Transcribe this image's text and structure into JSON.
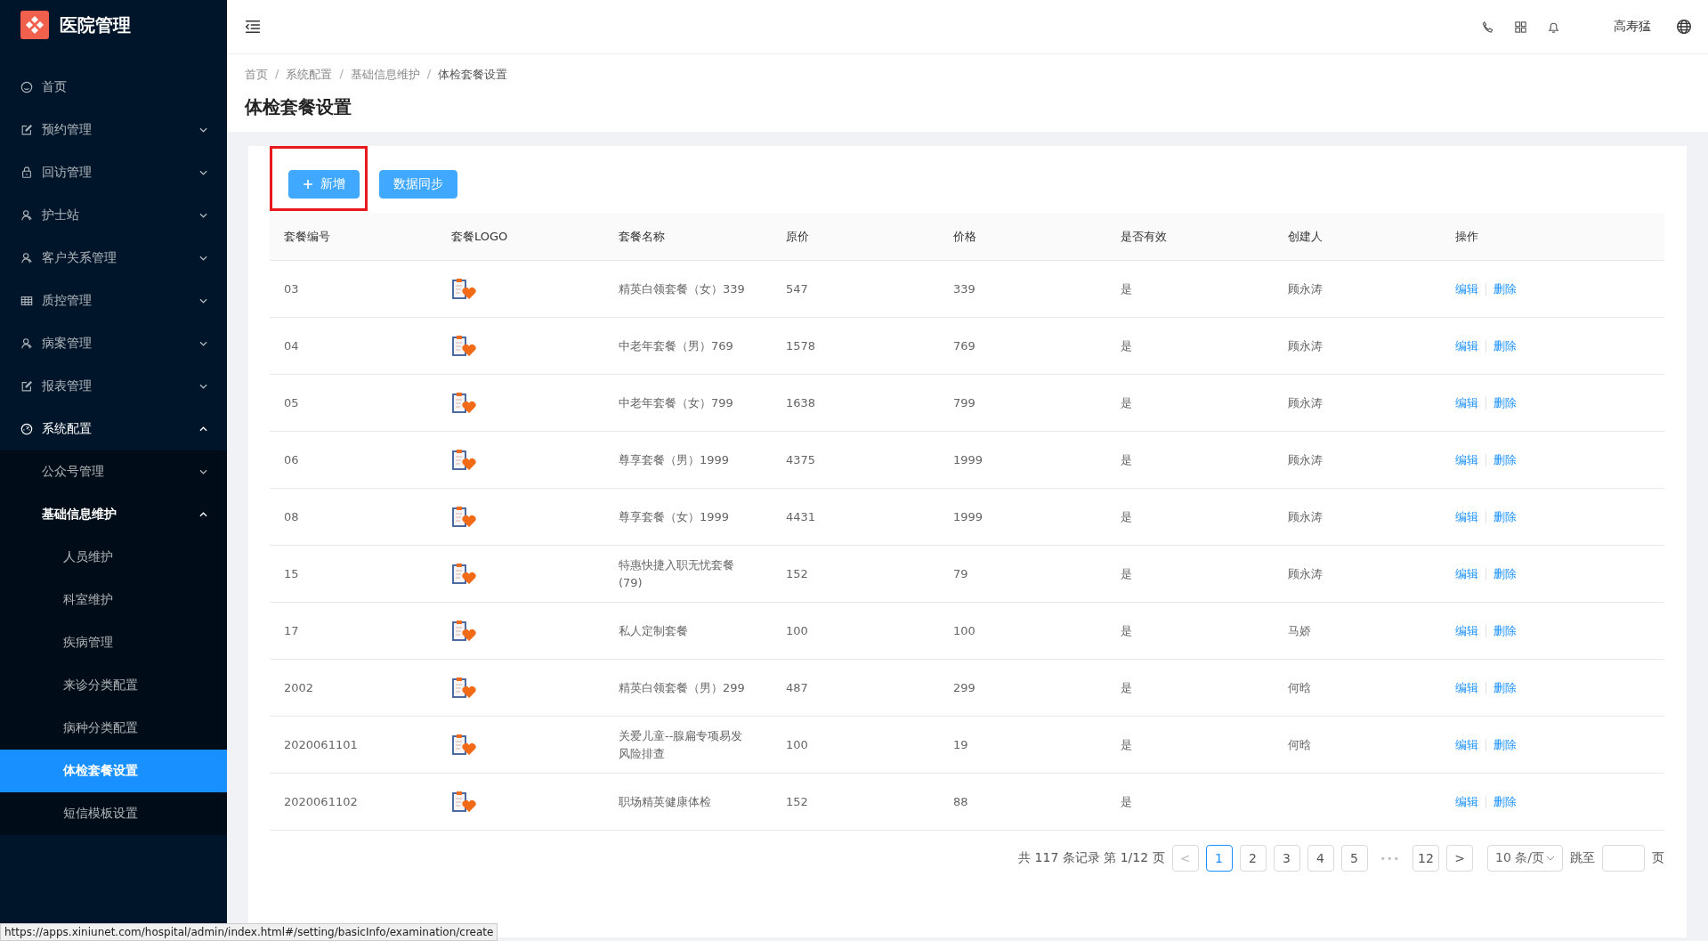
{
  "app": {
    "title": "医院管理"
  },
  "sidebar": {
    "items": [
      {
        "label": "首页",
        "kind": "link",
        "selected": false
      },
      {
        "label": "预约管理",
        "kind": "group",
        "expanded": false,
        "selected": false
      },
      {
        "label": "回访管理",
        "kind": "group",
        "expanded": false,
        "selected": false
      },
      {
        "label": "护士站",
        "kind": "group",
        "expanded": false,
        "selected": false
      },
      {
        "label": "客户关系管理",
        "kind": "group",
        "expanded": false,
        "selected": false
      },
      {
        "label": "质控管理",
        "kind": "group",
        "expanded": false,
        "selected": false
      },
      {
        "label": "病案管理",
        "kind": "group",
        "expanded": false,
        "selected": false
      },
      {
        "label": "报表管理",
        "kind": "group",
        "expanded": false,
        "selected": false
      },
      {
        "label": "系统配置",
        "kind": "group",
        "expanded": true,
        "selected": false,
        "children": [
          {
            "label": "公众号管理",
            "kind": "group",
            "expanded": false,
            "selected": false
          },
          {
            "label": "基础信息维护",
            "kind": "group",
            "expanded": true,
            "selected": false,
            "children": [
              {
                "label": "人员维护",
                "selected": false
              },
              {
                "label": "科室维护",
                "selected": false
              },
              {
                "label": "疾病管理",
                "selected": false
              },
              {
                "label": "来诊分类配置",
                "selected": false
              },
              {
                "label": "病种分类配置",
                "selected": false
              },
              {
                "label": "体检套餐设置",
                "selected": true
              },
              {
                "label": "短信模板设置",
                "selected": false
              }
            ]
          }
        ]
      }
    ]
  },
  "header": {
    "user": "高寿猛"
  },
  "breadcrumb": {
    "separator": "/",
    "items": [
      "首页",
      "系统配置",
      "基础信息维护",
      "体检套餐设置"
    ]
  },
  "page_title": "体检套餐设置",
  "toolbar": [
    {
      "label": "新增",
      "kind": "add",
      "highlighted": true
    },
    {
      "label": "数据同步",
      "kind": "plain",
      "highlighted": false
    }
  ],
  "table": {
    "columns": [
      "套餐编号",
      "套餐LOGO",
      "套餐名称",
      "原价",
      "价格",
      "是否有效",
      "创建人",
      "操作"
    ],
    "rows": [
      {
        "code": "03",
        "name": "精英白领套餐（女）339",
        "original_price": "547",
        "price": "339",
        "valid": "是",
        "creator": "顾永涛",
        "actions": [
          "编辑",
          "删除"
        ]
      },
      {
        "code": "04",
        "name": "中老年套餐（男）769",
        "original_price": "1578",
        "price": "769",
        "valid": "是",
        "creator": "顾永涛",
        "actions": [
          "编辑",
          "删除"
        ]
      },
      {
        "code": "05",
        "name": "中老年套餐（女）799",
        "original_price": "1638",
        "price": "799",
        "valid": "是",
        "creator": "顾永涛",
        "actions": [
          "编辑",
          "删除"
        ]
      },
      {
        "code": "06",
        "name": "尊享套餐（男）1999",
        "original_price": "4375",
        "price": "1999",
        "valid": "是",
        "creator": "顾永涛",
        "actions": [
          "编辑",
          "删除"
        ]
      },
      {
        "code": "08",
        "name": "尊享套餐（女）1999",
        "original_price": "4431",
        "price": "1999",
        "valid": "是",
        "creator": "顾永涛",
        "actions": [
          "编辑",
          "删除"
        ]
      },
      {
        "code": "15",
        "name": "特惠快捷入职无忧套餐(79)",
        "original_price": "152",
        "price": "79",
        "valid": "是",
        "creator": "顾永涛",
        "actions": [
          "编辑",
          "删除"
        ]
      },
      {
        "code": "17",
        "name": "私人定制套餐",
        "original_price": "100",
        "price": "100",
        "valid": "是",
        "creator": "马娇",
        "actions": [
          "编辑",
          "删除"
        ]
      },
      {
        "code": "2002",
        "name": "精英白领套餐（男）299",
        "original_price": "487",
        "price": "299",
        "valid": "是",
        "creator": "何晗",
        "actions": [
          "编辑",
          "删除"
        ]
      },
      {
        "code": "2020061101",
        "name": "关爱儿童--腺扁专项易发风险排查",
        "original_price": "100",
        "price": "19",
        "valid": "是",
        "creator": "何晗",
        "actions": [
          "编辑",
          "删除"
        ]
      },
      {
        "code": "2020061102",
        "name": "职场精英健康体检",
        "original_price": "152",
        "price": "88",
        "valid": "是",
        "actions": [
          "编辑",
          "删除"
        ]
      }
    ]
  },
  "pagination": {
    "summary": "共 117 条记录 第 1/12 页",
    "prev": "<",
    "pages": [
      {
        "label": "1",
        "selected": true
      },
      {
        "label": "2",
        "selected": false
      },
      {
        "label": "3",
        "selected": false
      },
      {
        "label": "4",
        "selected": false
      },
      {
        "label": "5",
        "selected": false
      }
    ],
    "ellipsis": "•••",
    "last": {
      "label": "12",
      "selected": false
    },
    "next": ">",
    "page_size": "10 条/页",
    "jump_label": "跳至",
    "jump_suffix": "页"
  },
  "status_bar": "https://apps.xiniunet.com/hospital/admin/index.html#/setting/basicInfo/examination/create"
}
